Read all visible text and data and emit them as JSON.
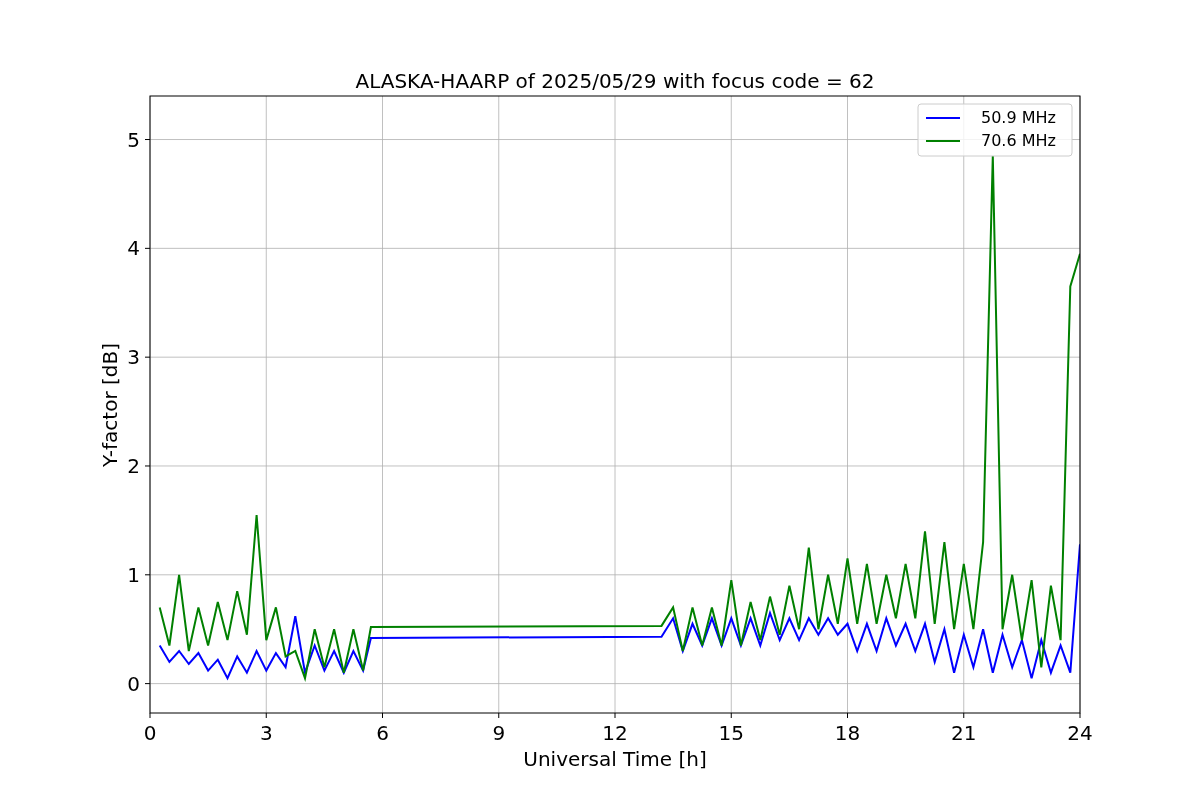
{
  "chart_data": {
    "type": "line",
    "title": "ALASKA-HAARP of 2025/05/29 with focus code = 62",
    "xlabel": "Universal Time [h]",
    "ylabel": "Y-factor [dB]",
    "x": [
      0.25,
      0.5,
      0.75,
      1,
      1.25,
      1.5,
      1.75,
      2,
      2.25,
      2.5,
      2.75,
      3,
      3.25,
      3.5,
      3.75,
      4,
      4.25,
      4.5,
      4.75,
      5,
      5.25,
      5.5,
      5.7,
      13.2,
      13.5,
      13.75,
      14,
      14.25,
      14.5,
      14.75,
      15,
      15.25,
      15.5,
      15.75,
      16,
      16.25,
      16.5,
      16.75,
      17,
      17.25,
      17.5,
      17.75,
      18,
      18.25,
      18.5,
      18.75,
      19,
      19.25,
      19.5,
      19.75,
      20,
      20.25,
      20.5,
      20.75,
      21,
      21.25,
      21.5,
      21.75,
      22,
      22.25,
      22.5,
      22.75,
      23,
      23.25,
      23.5,
      23.75,
      24
    ],
    "series": [
      {
        "name": "50.9 MHz",
        "color": "#0000ff",
        "values": [
          0.35,
          0.2,
          0.3,
          0.18,
          0.28,
          0.12,
          0.22,
          0.05,
          0.25,
          0.1,
          0.3,
          0.12,
          0.28,
          0.15,
          0.62,
          0.1,
          0.35,
          0.12,
          0.3,
          0.1,
          0.3,
          0.12,
          0.42,
          0.43,
          0.6,
          0.3,
          0.55,
          0.35,
          0.6,
          0.35,
          0.6,
          0.35,
          0.6,
          0.35,
          0.65,
          0.4,
          0.6,
          0.4,
          0.6,
          0.45,
          0.6,
          0.45,
          0.55,
          0.3,
          0.55,
          0.3,
          0.6,
          0.35,
          0.55,
          0.3,
          0.55,
          0.2,
          0.5,
          0.1,
          0.45,
          0.15,
          0.5,
          0.1,
          0.45,
          0.15,
          0.4,
          0.05,
          0.4,
          0.1,
          0.35,
          0.1,
          1.28
        ]
      },
      {
        "name": "70.6 MHz",
        "color": "#008000",
        "values": [
          0.7,
          0.35,
          1.0,
          0.3,
          0.7,
          0.35,
          0.75,
          0.4,
          0.85,
          0.45,
          1.55,
          0.4,
          0.7,
          0.25,
          0.3,
          0.05,
          0.5,
          0.15,
          0.5,
          0.1,
          0.5,
          0.12,
          0.52,
          0.53,
          0.7,
          0.3,
          0.7,
          0.35,
          0.7,
          0.35,
          0.95,
          0.35,
          0.75,
          0.4,
          0.8,
          0.45,
          0.9,
          0.5,
          1.25,
          0.5,
          1.0,
          0.55,
          1.15,
          0.55,
          1.1,
          0.55,
          1.0,
          0.6,
          1.1,
          0.6,
          1.4,
          0.55,
          1.3,
          0.5,
          1.1,
          0.5,
          1.3,
          4.85,
          0.5,
          1.0,
          0.4,
          0.95,
          0.15,
          0.9,
          0.4,
          3.65,
          3.95
        ]
      }
    ],
    "xlim": [
      0,
      24
    ],
    "ylim": [
      -0.27,
      5.4
    ],
    "xticks": [
      0,
      3,
      6,
      9,
      12,
      15,
      18,
      21,
      24
    ],
    "yticks": [
      0,
      1,
      2,
      3,
      4,
      5
    ],
    "grid": true,
    "legend": true
  }
}
